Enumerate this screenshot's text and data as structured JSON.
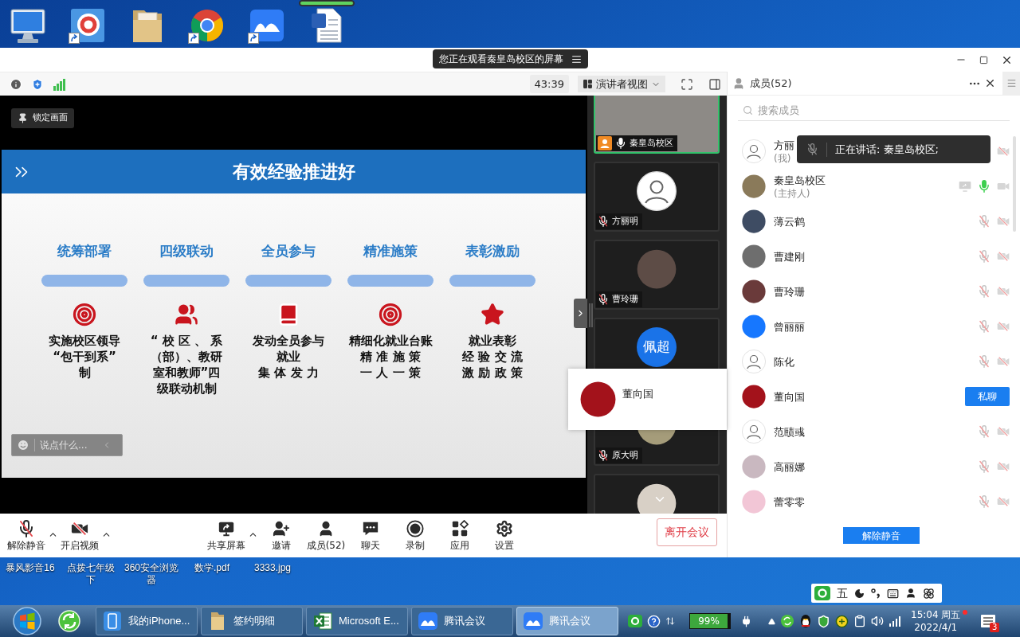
{
  "desktop_icons": [
    {
      "shortcut": false
    },
    {
      "shortcut": true
    },
    {
      "shortcut": false
    },
    {
      "shortcut": true
    },
    {
      "shortcut": true
    },
    {
      "shortcut": false,
      "progress": {
        "level": 1
      }
    }
  ],
  "meeting": {
    "sharing_banner": "您正在观看秦皇岛校区的屏幕",
    "timer": "43:39",
    "view_mode": "演讲者视图",
    "shared_screen": {
      "lock_button": "锁定画面",
      "slide_title": "有效经验推进好",
      "columns": [
        {
          "heading": "统筹部署",
          "lines": [
            "实施校区领导",
            "“包干到系”",
            "制"
          ]
        },
        {
          "heading": "四级联动",
          "lines": [
            "“ 校 区 、 系",
            "（部）、教研",
            "室和教师”四",
            "级联动机制"
          ]
        },
        {
          "heading": "全员参与",
          "lines": [
            "发动全员参与",
            "就业",
            "集 体 发 力"
          ]
        },
        {
          "heading": "精准施策",
          "lines": [
            "精细化就业台账",
            "精 准 施 策",
            "一 人 一 策"
          ]
        },
        {
          "heading": "表彰激励",
          "lines": [
            "就业表彰",
            "经 验 交 流",
            "激 励 政 策"
          ]
        }
      ],
      "chat_input": {
        "placeholder": "说点什么..."
      }
    },
    "video_tiles": [
      {
        "name": "秦皇岛校区",
        "kind": "video",
        "muted": false,
        "host": true,
        "speaking": true
      },
      {
        "name": "方丽明",
        "kind": "avatar",
        "muted": true,
        "host": false,
        "speaking": false
      },
      {
        "name": "曹玲珊",
        "kind": "avatar",
        "muted": true,
        "host": false,
        "speaking": false
      },
      {
        "kind": "initials",
        "initials": "佩超",
        "host": false,
        "speaking": false
      },
      {
        "name": "原大明",
        "kind": "avatar",
        "muted": true,
        "host": false,
        "speaking": false
      },
      {
        "kind": "avatar",
        "host": false,
        "speaking": false
      }
    ],
    "hover_card": {
      "name": "董向国"
    },
    "toolbar": [
      {
        "label": "解除静音",
        "off": true,
        "menu": true
      },
      {
        "label": "开启视频",
        "off": true,
        "menu": true
      },
      {
        "label": "共享屏幕",
        "menu": true
      },
      {
        "label": "邀请",
        "menu": false
      },
      {
        "label": "成员(52)",
        "menu": false
      },
      {
        "label": "聊天",
        "menu": false
      },
      {
        "label": "录制",
        "menu": false
      },
      {
        "label": "应用",
        "menu": false
      },
      {
        "label": "设置",
        "menu": false
      }
    ],
    "leave_button": "离开会议",
    "members_panel": {
      "title": "成员(52)",
      "search": {
        "placeholder": "搜索成员"
      },
      "members": [
        {
          "name": "方丽",
          "note": "(我)",
          "video": false
        },
        {
          "name": "秦皇岛校区",
          "note": "(主持人)",
          "sharing": true,
          "muted": false,
          "video": true
        },
        {
          "name": "薄云鹤",
          "muted": true,
          "video": false
        },
        {
          "name": "曹建刚",
          "muted": true,
          "video": false
        },
        {
          "name": "曹玲珊",
          "muted": true,
          "video": false
        },
        {
          "name": "曾丽丽",
          "muted": true,
          "video": false
        },
        {
          "name": "陈化",
          "muted": true,
          "video": false
        },
        {
          "name": "董向国",
          "action": "私聊"
        },
        {
          "name": "范赜彧",
          "muted": true,
          "video": false
        },
        {
          "name": "高丽娜",
          "muted": true,
          "video": false
        },
        {
          "name": "蕾零零",
          "muted": true,
          "video": false
        }
      ],
      "speaking_tooltip": "正在讲话: 秦皇岛校区;",
      "unmute_button": "解除静音"
    }
  },
  "desktop_files": [
    "暴风影音16",
    "点拨七年级下",
    "360安全浏览器",
    "数学.pdf",
    "3333.jpg"
  ],
  "ime_bar": {
    "mode": "五"
  },
  "taskbar": {
    "tasks": [
      {
        "label": "我的iPhone...",
        "selected": false
      },
      {
        "label": "签约明细",
        "selected": false
      },
      {
        "label": "Microsoft E...",
        "selected": false
      },
      {
        "label": "腾讯会议",
        "selected": false
      },
      {
        "label": "腾讯会议",
        "selected": true
      }
    ],
    "battery": "99%",
    "clock": {
      "time": "15:04 周五",
      "date": "2022/4/1"
    },
    "notifications": "3"
  }
}
